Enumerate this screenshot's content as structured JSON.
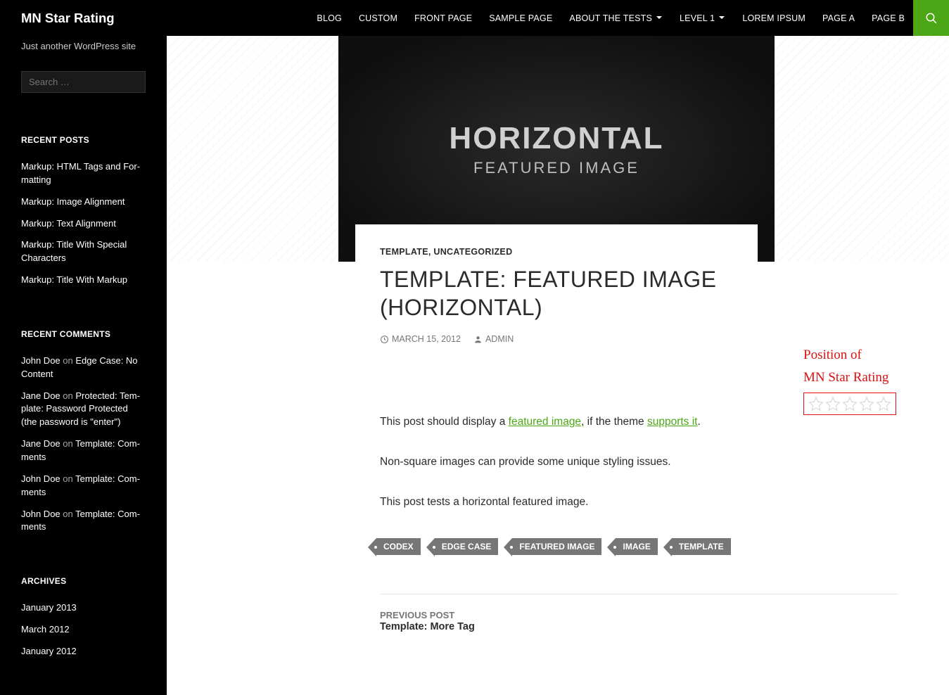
{
  "site": {
    "title": "MN Star Rating",
    "tagline": "Just another WordPress site"
  },
  "nav": {
    "items": [
      {
        "label": "BLOG",
        "has_children": false
      },
      {
        "label": "CUSTOM",
        "has_children": false
      },
      {
        "label": "FRONT PAGE",
        "has_children": false
      },
      {
        "label": "SAMPLE PAGE",
        "has_children": false
      },
      {
        "label": "ABOUT THE TESTS",
        "has_children": true
      },
      {
        "label": "LEVEL 1",
        "has_children": true
      },
      {
        "label": "LOREM IPSUM",
        "has_children": false
      },
      {
        "label": "PAGE A",
        "has_children": false
      },
      {
        "label": "PAGE B",
        "has_children": false
      }
    ]
  },
  "search": {
    "placeholder": "Search …"
  },
  "widgets": {
    "recent_posts": {
      "title": "RECENT POSTS",
      "items": [
        "Markup: HTML Tags and For­matting",
        "Markup: Image Alignment",
        "Markup: Text Alignment",
        "Markup: Title With Special Characters",
        "Markup: Title With Markup"
      ]
    },
    "recent_comments": {
      "title": "RECENT COMMENTS",
      "items": [
        {
          "author": "John Doe",
          "on": "on",
          "post": "Edge Case: No Content"
        },
        {
          "author": "Jane Doe",
          "on": "on",
          "post": "Protected: Tem­plate: Password Protected (the password is \"enter\")"
        },
        {
          "author": "Jane Doe",
          "on": "on",
          "post": "Template: Com­ments"
        },
        {
          "author": "John Doe",
          "on": "on",
          "post": "Template: Com­ments"
        },
        {
          "author": "John Doe",
          "on": "on",
          "post": "Template: Com­ments"
        }
      ]
    },
    "archives": {
      "title": "ARCHIVES",
      "items": [
        "January 2013",
        "March 2012",
        "January 2012"
      ]
    }
  },
  "hero": {
    "big": "HORIZONTAL",
    "small": "FEATURED IMAGE"
  },
  "post": {
    "categories": [
      "TEMPLATE",
      "UNCATEGORIZED"
    ],
    "cat_sep": ", ",
    "title": "TEMPLATE: FEATURED IMAGE (HORIZONTAL)",
    "date": "MARCH 15, 2012",
    "author": "ADMIN",
    "body": {
      "p1_a": "This post should display a ",
      "p1_link1": "featured image",
      "p1_b": ", if the theme ",
      "p1_link2": "supports it",
      "p1_c": ".",
      "p2": "Non-square images can provide some unique styling issues.",
      "p3": "This post tests a horizontal featured image."
    },
    "tags": [
      "CODEX",
      "EDGE CASE",
      "FEATURED IMAGE",
      "IMAGE",
      "TEMPLATE"
    ]
  },
  "annotation": {
    "line1": "Position of",
    "line2": "MN Star Rating"
  },
  "prevnext": {
    "label": "PREVIOUS POST",
    "title": "Template: More Tag"
  }
}
